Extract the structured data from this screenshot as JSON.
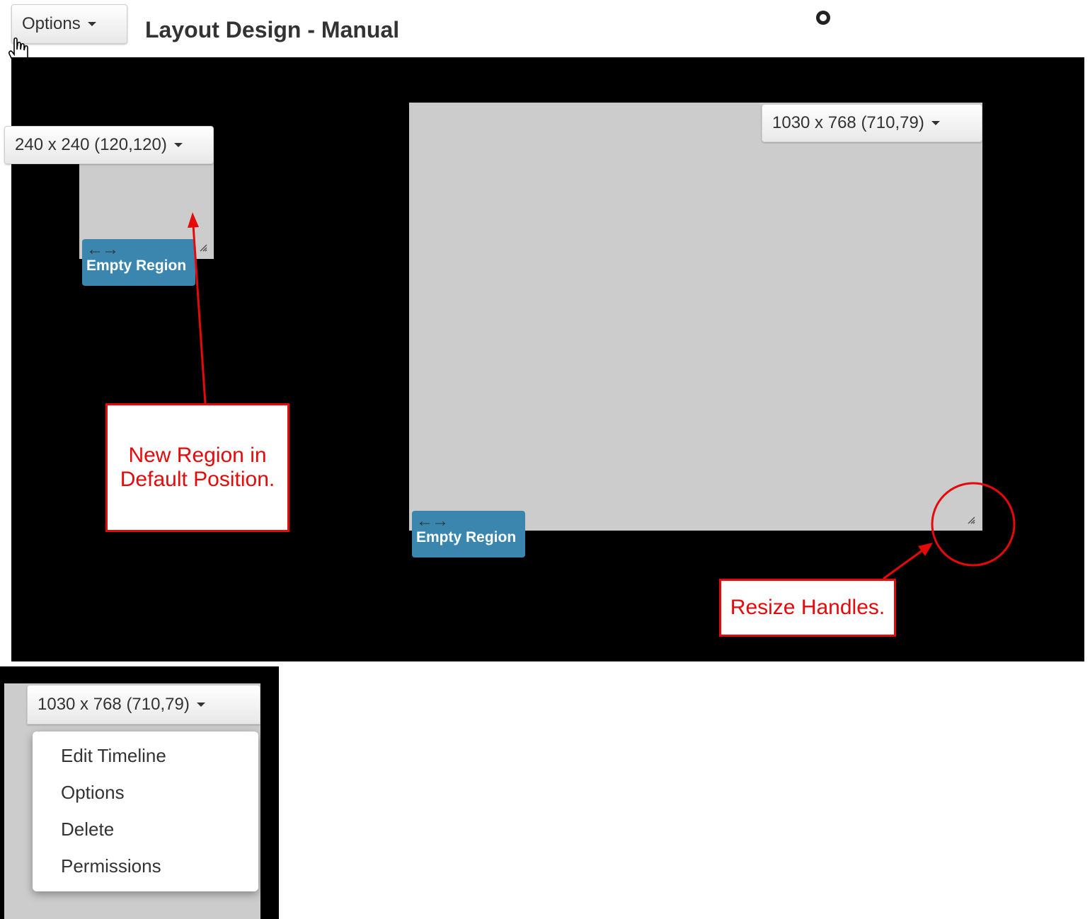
{
  "header": {
    "options_label": "Options",
    "title": "Layout Design - Manual"
  },
  "regions": [
    {
      "dims_label": "240 x 240 (120,120)",
      "name": "Empty Region"
    },
    {
      "dims_label": "1030 x 768 (710,79)",
      "name": "Empty Region"
    }
  ],
  "annotations": {
    "new_region": "New Region in Default Position.",
    "resize": "Resize Handles."
  },
  "inset": {
    "dims_label": "1030 x 768 (710,79)",
    "menu": [
      "Edit Timeline",
      "Options",
      "Delete",
      "Permissions"
    ]
  },
  "colors": {
    "canvas": "#000000",
    "region": "#cccccc",
    "region_label": "#3a86ae",
    "annotation": "#e5090a"
  }
}
